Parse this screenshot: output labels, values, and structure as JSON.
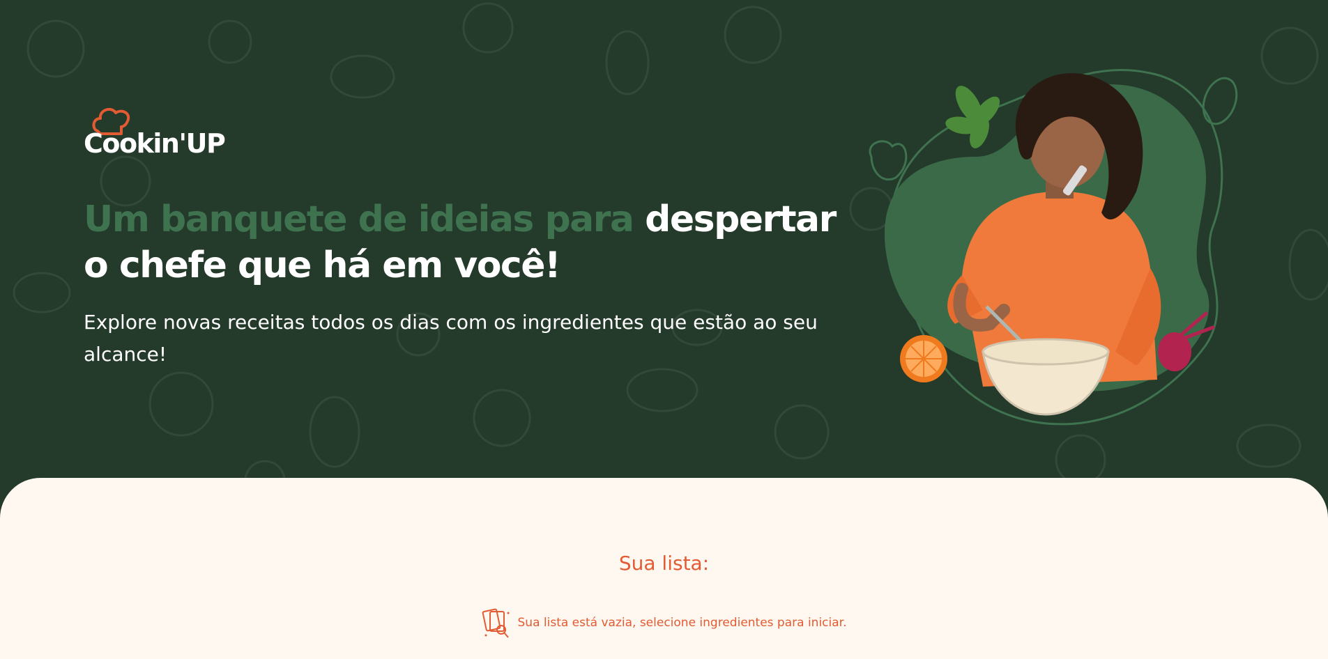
{
  "brand": {
    "name": "Cookin'UP",
    "logo_icon": "chef-hat-icon",
    "accent_color": "#e35b32",
    "dark_green": "#243a2b",
    "mid_green": "#3f7350"
  },
  "hero": {
    "headline_highlight": "Um banquete de ideias para",
    "headline_rest": "despertar o chefe que há em você!",
    "subtitle": "Explore novas receitas todos os dias com os ingredientes que estão ao seu alcance!"
  },
  "list": {
    "title": "Sua lista:",
    "empty_icon": "empty-list-icon",
    "empty_message": "Sua lista está vazia, selecione ingredientes para iniciar."
  }
}
